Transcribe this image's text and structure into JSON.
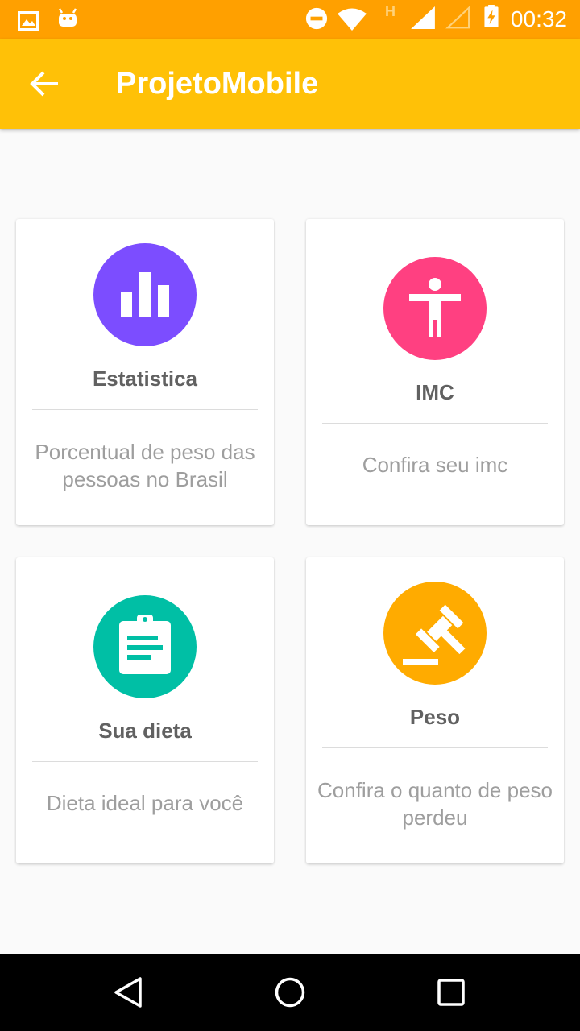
{
  "status_bar": {
    "time": "00:32",
    "icons": [
      "image-icon",
      "android-icon",
      "do-not-disturb-icon",
      "wifi-icon",
      "h-network-icon",
      "signal-icon",
      "signal-empty-icon",
      "battery-charging-icon"
    ],
    "network_label": "H"
  },
  "app_bar": {
    "title": "ProjetoMobile",
    "back_icon": "arrow-back-icon",
    "color": "#ffc107"
  },
  "cards": [
    {
      "title": "Estatistica",
      "description": "Porcentual de peso das pessoas no Brasil",
      "icon": "bar-chart-icon",
      "color": "#7c4dff"
    },
    {
      "title": "IMC",
      "description": "Confira seu imc",
      "icon": "person-icon",
      "color": "#ff4081"
    },
    {
      "title": "Sua dieta",
      "description": "Dieta ideal para você",
      "icon": "clipboard-icon",
      "color": "#00bfa5"
    },
    {
      "title": "Peso",
      "description": "Confira o quanto de peso perdeu",
      "icon": "gavel-icon",
      "color": "#ffab00"
    }
  ],
  "nav_bar": {
    "buttons": [
      "back-triangle-icon",
      "home-circle-icon",
      "recents-square-icon"
    ]
  }
}
